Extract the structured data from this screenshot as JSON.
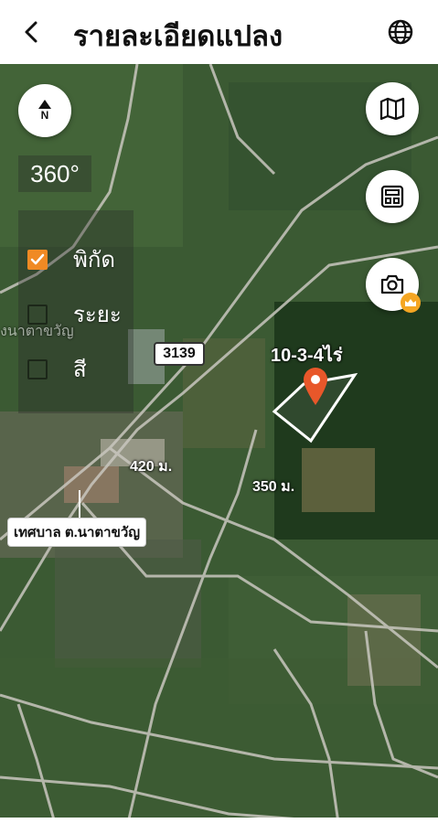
{
  "header": {
    "title": "รายละเอียดแปลง"
  },
  "map": {
    "compass_label": "N",
    "rotation_label": "360°",
    "toggles": [
      {
        "label": "พิกัด",
        "checked": true
      },
      {
        "label": "ระยะ",
        "checked": false
      },
      {
        "label": "สี",
        "checked": false
      }
    ],
    "road_number": "3139",
    "plot_area_label": "10-3-4ไร่",
    "distances": [
      "420 ม.",
      "350 ม."
    ],
    "place_name": "เทศบาล ต.นาตาขวัญ",
    "faint_label": "งนาตาขวัญ",
    "colors": {
      "accent": "#f08a24",
      "pin": "#e8572a",
      "crown_badge": "#f5a623"
    },
    "icons": [
      "back-arrow-icon",
      "globe-icon",
      "compass-icon",
      "map-icon",
      "calculator-icon",
      "camera-icon",
      "crown-icon",
      "location-pin-icon"
    ]
  }
}
